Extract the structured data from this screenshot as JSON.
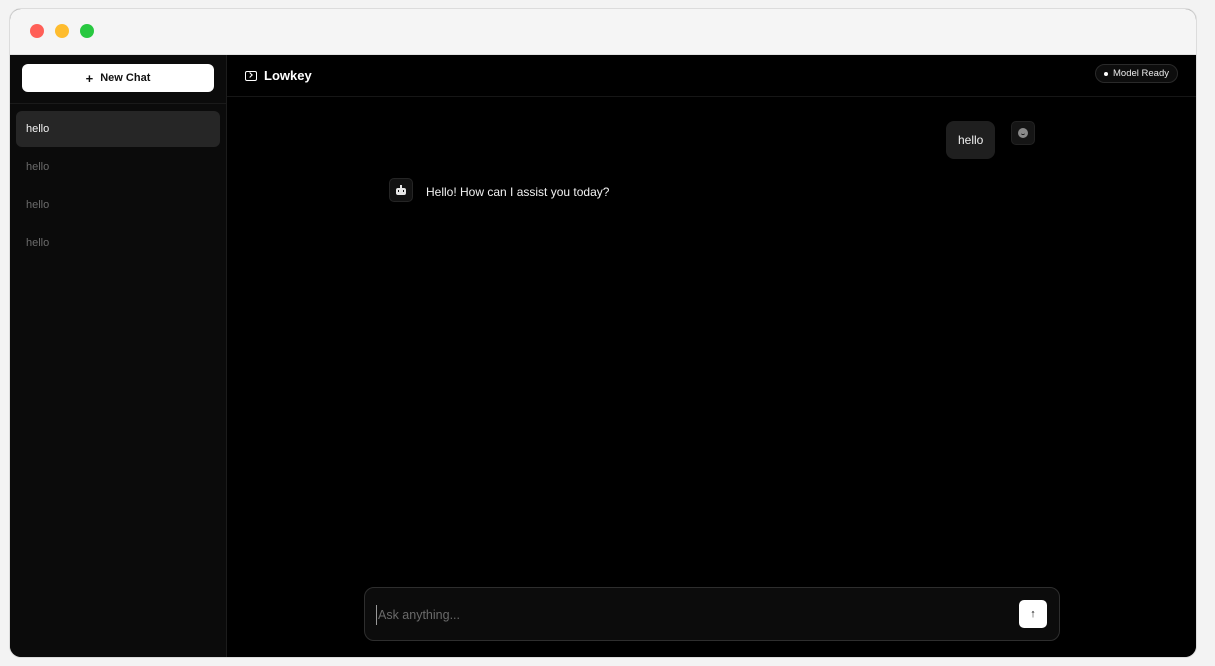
{
  "app": {
    "title": "Lowkey"
  },
  "status": {
    "label": "Model Ready"
  },
  "sidebar": {
    "new_chat_label": "New Chat",
    "history": [
      {
        "label": "hello",
        "active": true
      },
      {
        "label": "hello",
        "active": false
      },
      {
        "label": "hello",
        "active": false
      },
      {
        "label": "hello",
        "active": false
      }
    ]
  },
  "conversation": {
    "messages": [
      {
        "role": "user",
        "text": "hello"
      },
      {
        "role": "assistant",
        "text": "Hello! How can I assist you today?"
      }
    ]
  },
  "composer": {
    "placeholder": "Ask anything...",
    "value": ""
  },
  "icons": {
    "logo": "terminal-icon",
    "user_avatar": "smiley-icon",
    "bot_avatar": "robot-icon",
    "send": "arrow-up-icon",
    "new_chat": "plus-icon"
  },
  "colors": {
    "background": "#000000",
    "sidebar": "#0b0b0b",
    "active_item": "#262626",
    "user_bubble": "#1f1f1f",
    "accent": "#ffffff"
  }
}
